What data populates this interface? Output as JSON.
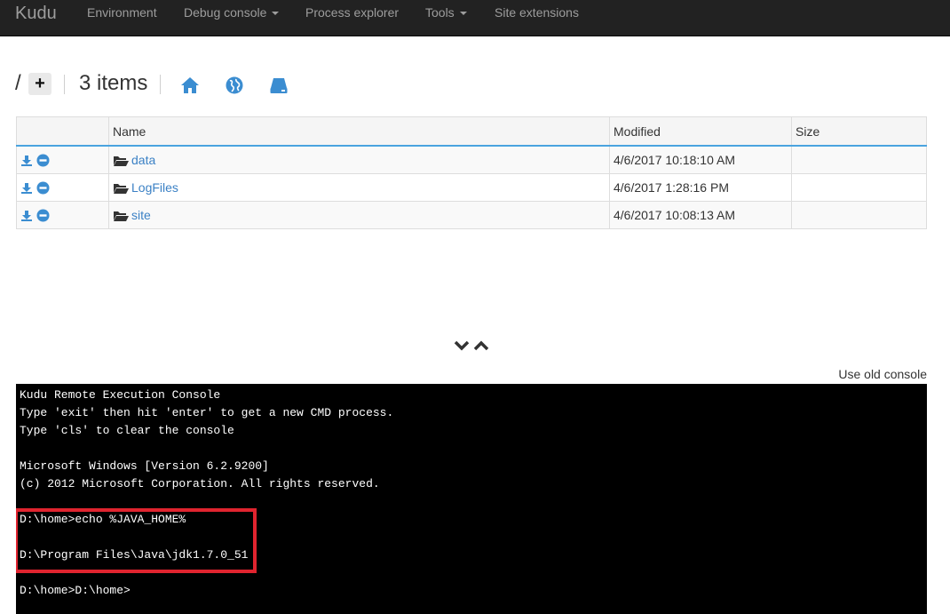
{
  "nav": {
    "brand": "Kudu",
    "items": [
      {
        "label": "Environment"
      },
      {
        "label": "Debug console"
      },
      {
        "label": "Process explorer"
      },
      {
        "label": "Tools"
      },
      {
        "label": "Site extensions"
      }
    ]
  },
  "toolbar": {
    "path": "/",
    "add_label": "+",
    "items_count": "3 items",
    "icons": [
      "home-icon",
      "globe-icon",
      "drive-icon"
    ]
  },
  "files": {
    "columns": [
      "Name",
      "Modified",
      "Size"
    ],
    "rows": [
      {
        "name": "data",
        "modified": "4/6/2017 10:18:10 AM",
        "size": ""
      },
      {
        "name": "LogFiles",
        "modified": "4/6/2017 1:28:16 PM",
        "size": ""
      },
      {
        "name": "site",
        "modified": "4/6/2017 10:08:13 AM",
        "size": ""
      }
    ]
  },
  "console": {
    "old_console_link": "Use old console",
    "lines": [
      "Kudu Remote Execution Console",
      "Type 'exit' then hit 'enter' to get a new CMD process.",
      "Type 'cls' to clear the console",
      "",
      "Microsoft Windows [Version 6.2.9200]",
      "(c) 2012 Microsoft Corporation. All rights reserved.",
      "",
      "D:\\home>echo %JAVA_HOME%",
      "",
      "D:\\Program Files\\Java\\jdk1.7.0_51",
      "",
      "D:\\home>D:\\home>"
    ]
  },
  "colors": {
    "navbar": "#222222",
    "link": "#3b81c5",
    "icon_blue": "#3b8dd1",
    "highlight": "#e0242f"
  }
}
